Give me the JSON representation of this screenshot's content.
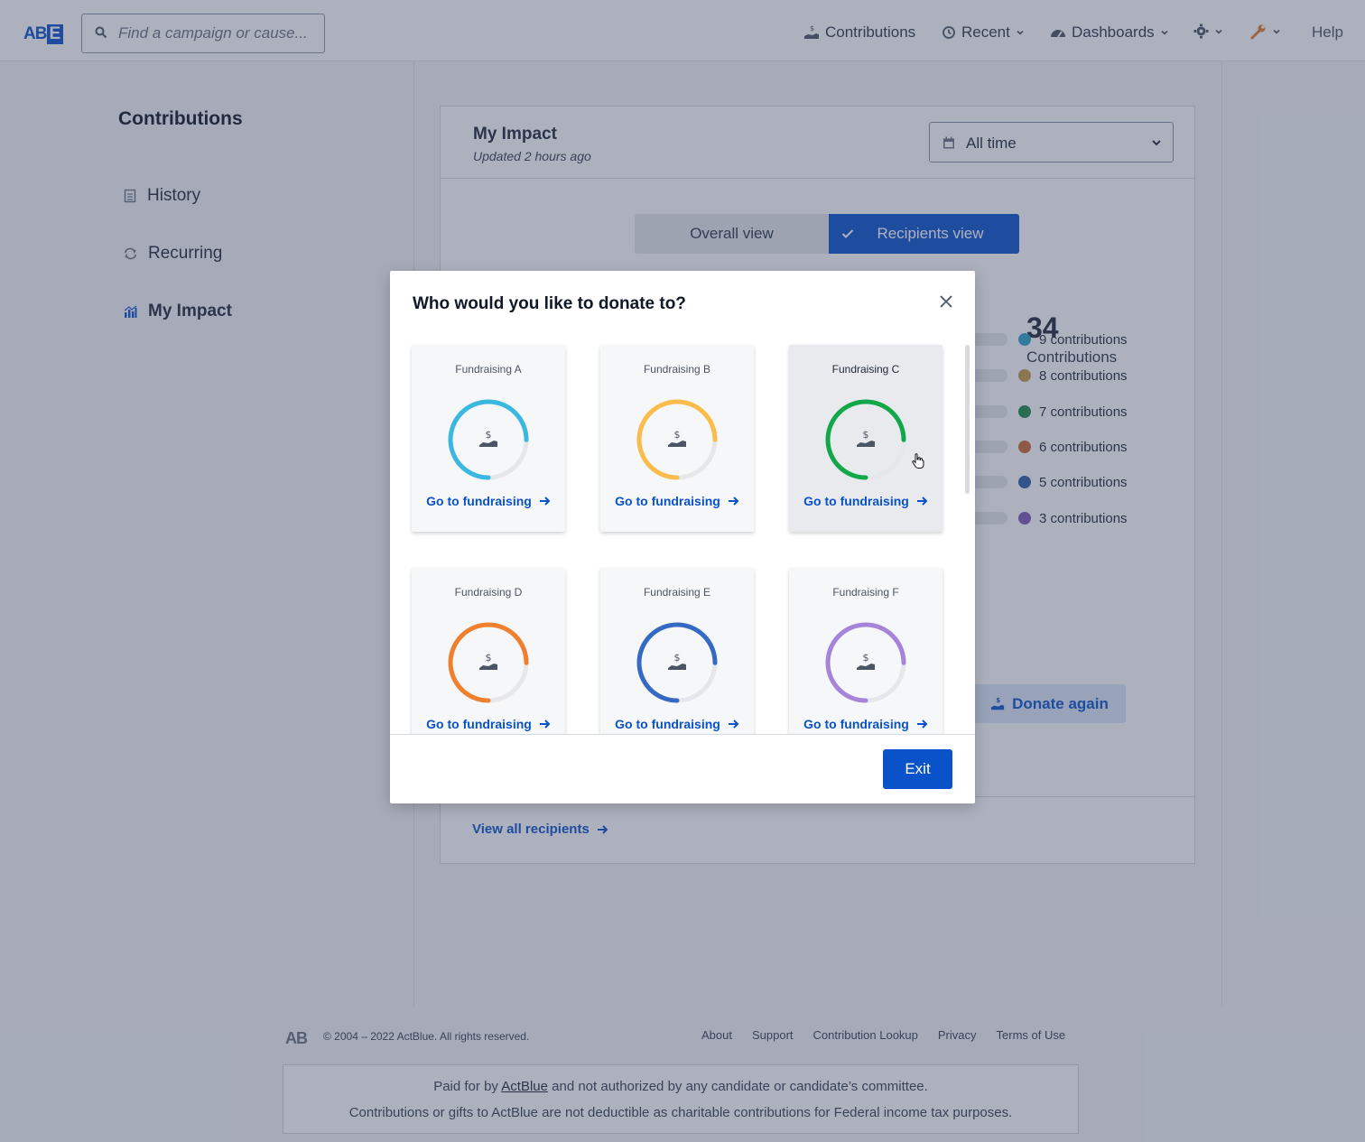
{
  "header": {
    "logo_text": "AB",
    "logo_badge": "E",
    "search_placeholder": "Find a campaign or cause...",
    "nav": {
      "contributions": "Contributions",
      "recent": "Recent",
      "dashboards": "Dashboards",
      "settings_icon": "gear-icon",
      "tools_icon": "wrench-icon",
      "help": "Help"
    }
  },
  "sidebar": {
    "title": "Contributions",
    "items": [
      {
        "label": "History",
        "icon": "document-icon",
        "active": false
      },
      {
        "label": "Recurring",
        "icon": "repeat-icon",
        "active": false
      },
      {
        "label": "My Impact",
        "icon": "chart-icon",
        "active": true
      }
    ]
  },
  "impact": {
    "title": "My Impact",
    "updated": "Updated 2 hours ago",
    "range": "All time",
    "views": {
      "overall": "Overall view",
      "recipients": "Recipients view",
      "selected": "recipients"
    },
    "total_count": "34",
    "total_label": "Contributions",
    "legend": [
      {
        "label": "9 contributions",
        "color": "#2ea3c9"
      },
      {
        "label": "8 contributions",
        "color": "#c39b46"
      },
      {
        "label": "7 contributions",
        "color": "#1e8a46"
      },
      {
        "label": "6 contributions",
        "color": "#c86a32"
      },
      {
        "label": "5 contributions",
        "color": "#2f5ea6"
      },
      {
        "label": "3 contributions",
        "color": "#7c5ab3"
      }
    ],
    "donate_again": "Donate again",
    "view_all": "View all recipients"
  },
  "modal": {
    "title": "Who would you like to donate to?",
    "cards": [
      {
        "name": "Fundraising A",
        "color": "#3ab8e0",
        "link": "Go to fundraising"
      },
      {
        "name": "Fundraising B",
        "color": "#fbbc4c",
        "link": "Go to fundraising"
      },
      {
        "name": "Fundraising C",
        "color": "#12a84a",
        "link": "Go to fundraising"
      },
      {
        "name": "Fundraising D",
        "color": "#f07f2e",
        "link": "Go to fundraising"
      },
      {
        "name": "Fundraising E",
        "color": "#3469c4",
        "link": "Go to fundraising"
      },
      {
        "name": "Fundraising F",
        "color": "#a684d9",
        "link": "Go to fundraising"
      }
    ],
    "exit": "Exit"
  },
  "footer": {
    "logo": "AB",
    "copyright": "© 2004 – 2022 ActBlue. All rights reserved.",
    "links": [
      "About",
      "Support",
      "Contribution Lookup",
      "Privacy",
      "Terms of Use"
    ],
    "note_prefix": "Paid for by",
    "note_link": "ActBlue",
    "note_suffix": "and not authorized by any candidate or candidate’s committee.",
    "note_line2": "Contributions or gifts to ActBlue are not deductible as charitable contributions for Federal income tax purposes."
  }
}
